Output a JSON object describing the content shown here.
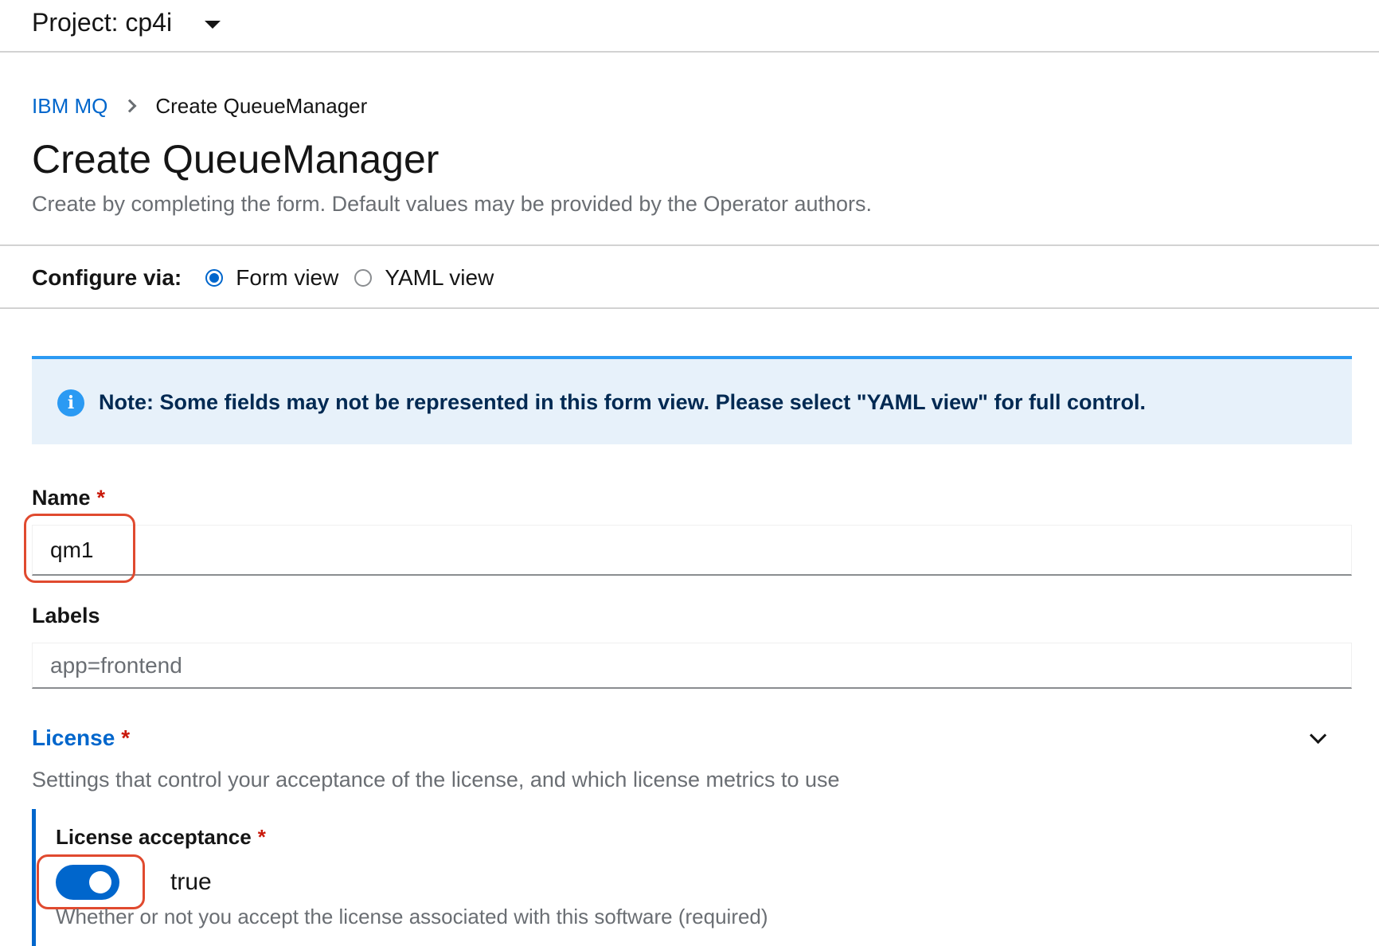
{
  "header": {
    "project_label": "Project: cp4i"
  },
  "breadcrumb": {
    "parent": "IBM MQ",
    "current": "Create QueueManager"
  },
  "page": {
    "title": "Create QueueManager",
    "subtitle": "Create by completing the form. Default values may be provided by the Operator authors."
  },
  "configure": {
    "label": "Configure via:",
    "options": [
      {
        "label": "Form view",
        "selected": true
      },
      {
        "label": "YAML view",
        "selected": false
      }
    ]
  },
  "alert": {
    "icon": "info-icon",
    "text": "Note: Some fields may not be represented in this form view. Please select \"YAML view\" for full control."
  },
  "form": {
    "name": {
      "label": "Name",
      "required_mark": "*",
      "value": "qm1"
    },
    "labels": {
      "label": "Labels",
      "placeholder": "app=frontend",
      "value": ""
    }
  },
  "license_section": {
    "title": "License",
    "required_mark": "*",
    "description": "Settings that control your acceptance of the license, and which license metrics to use",
    "acceptance": {
      "label": "License acceptance",
      "required_mark": "*",
      "toggle_on": true,
      "toggle_text": "true",
      "helper": "Whether or not you accept the license associated with this software (required)"
    }
  },
  "colors": {
    "link": "#0066cc",
    "alert_bg": "#e7f1fa",
    "alert_border": "#2b9af3",
    "required": "#c9190b",
    "highlight": "#e04a2f"
  }
}
